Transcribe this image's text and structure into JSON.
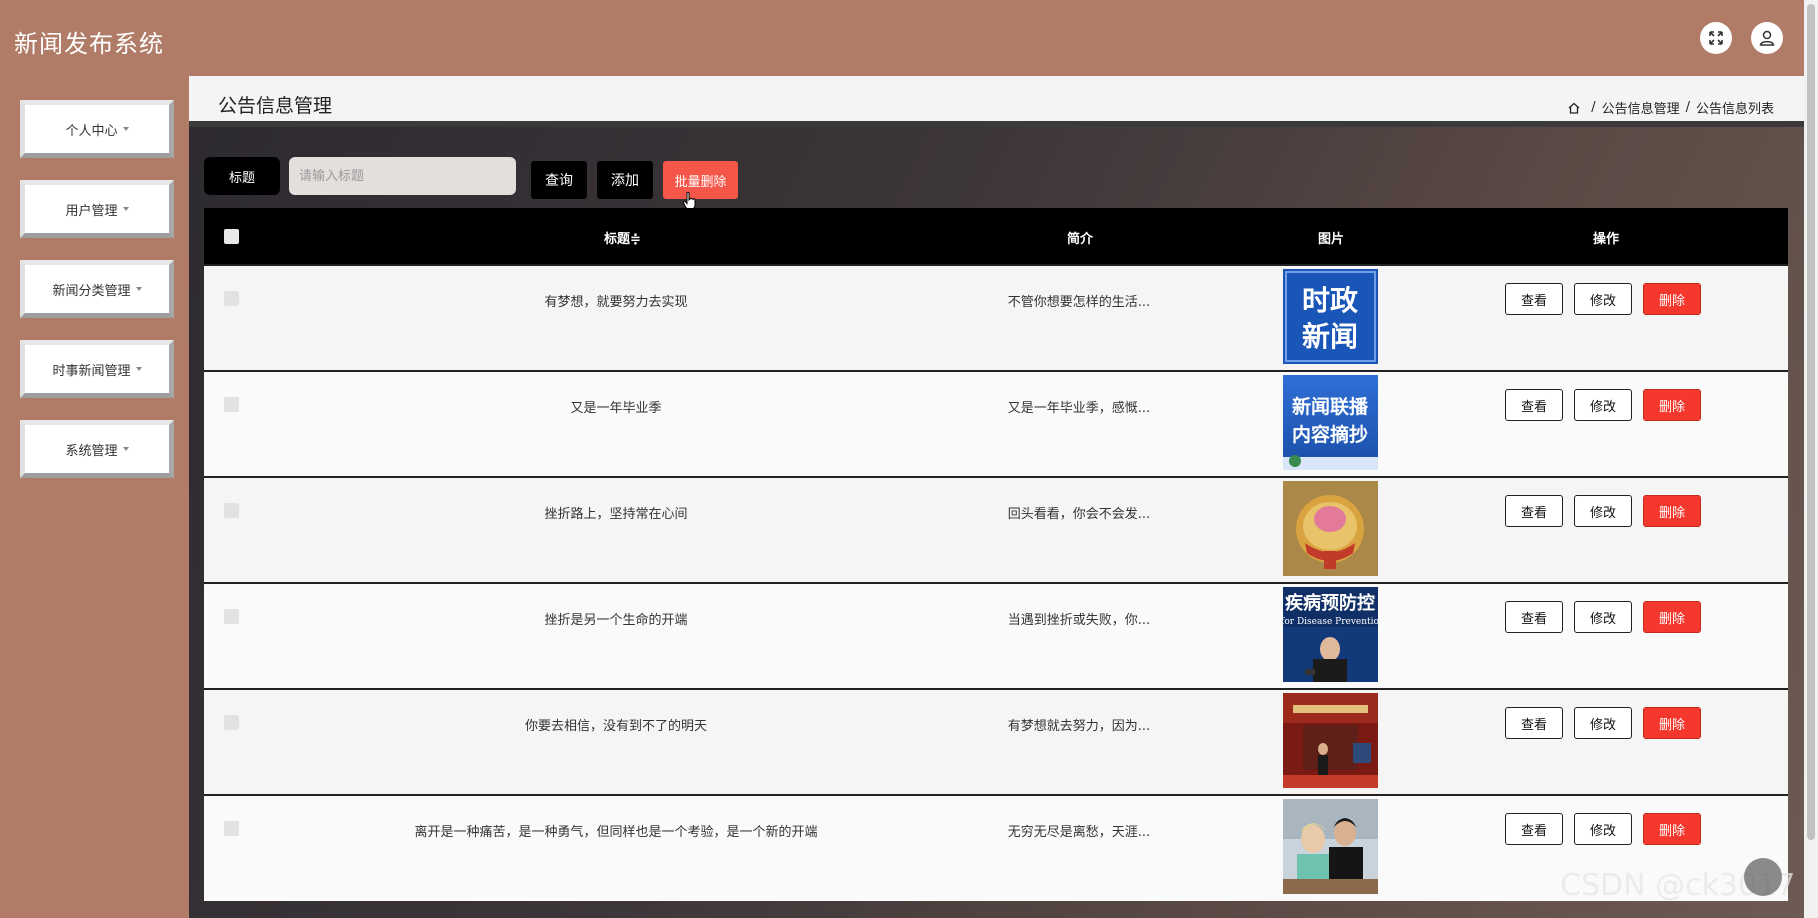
{
  "app": {
    "title": "新闻发布系统"
  },
  "sidebar": {
    "items": [
      {
        "label": "个人中心"
      },
      {
        "label": "用户管理"
      },
      {
        "label": "新闻分类管理"
      },
      {
        "label": "时事新闻管理"
      },
      {
        "label": "系统管理"
      }
    ]
  },
  "header": {
    "title": "公告信息管理",
    "breadcrumb": [
      "公告信息管理",
      "公告信息列表"
    ],
    "breadcrumb_sep": "/"
  },
  "search": {
    "label": "标题",
    "placeholder": "请输入标题",
    "query_label": "查询",
    "add_label": "添加",
    "batch_delete_label": "批量删除"
  },
  "table": {
    "columns": {
      "title": "标题",
      "sort_mark": "≑",
      "intro": "简介",
      "image": "图片",
      "actions": "操作"
    },
    "actions": {
      "view": "查看",
      "edit": "修改",
      "delete": "删除"
    },
    "rows": [
      {
        "title": "有梦想，就要努力去实现",
        "intro": "不管你想要怎样的生活...",
        "image_text": [
          "时政",
          "新闻"
        ]
      },
      {
        "title": "又是一年毕业季",
        "intro": "又是一年毕业季，感慨...",
        "image_text": [
          "新闻联播",
          "内容摘抄"
        ]
      },
      {
        "title": "挫折路上，坚持常在心间",
        "intro": "回头看看，你会不会发...",
        "image_text": []
      },
      {
        "title": "挫折是另一个生命的开端",
        "intro": "当遇到挫折或失败，你...",
        "image_text": [
          "疾病预防控",
          "for Disease Preventio"
        ]
      },
      {
        "title": "你要去相信，没有到不了的明天",
        "intro": "有梦想就去努力，因为...",
        "image_text": []
      },
      {
        "title": "离开是一种痛苦，是一种勇气，但同样也是一个考验，是一个新的开端",
        "intro": "无穷无尽是离愁，天涯...",
        "image_text": []
      }
    ]
  },
  "watermark": "CSDN @ck3017",
  "colors": {
    "bar": "#b07c67",
    "danger": "#f4382e",
    "batch": "#f4564a"
  }
}
